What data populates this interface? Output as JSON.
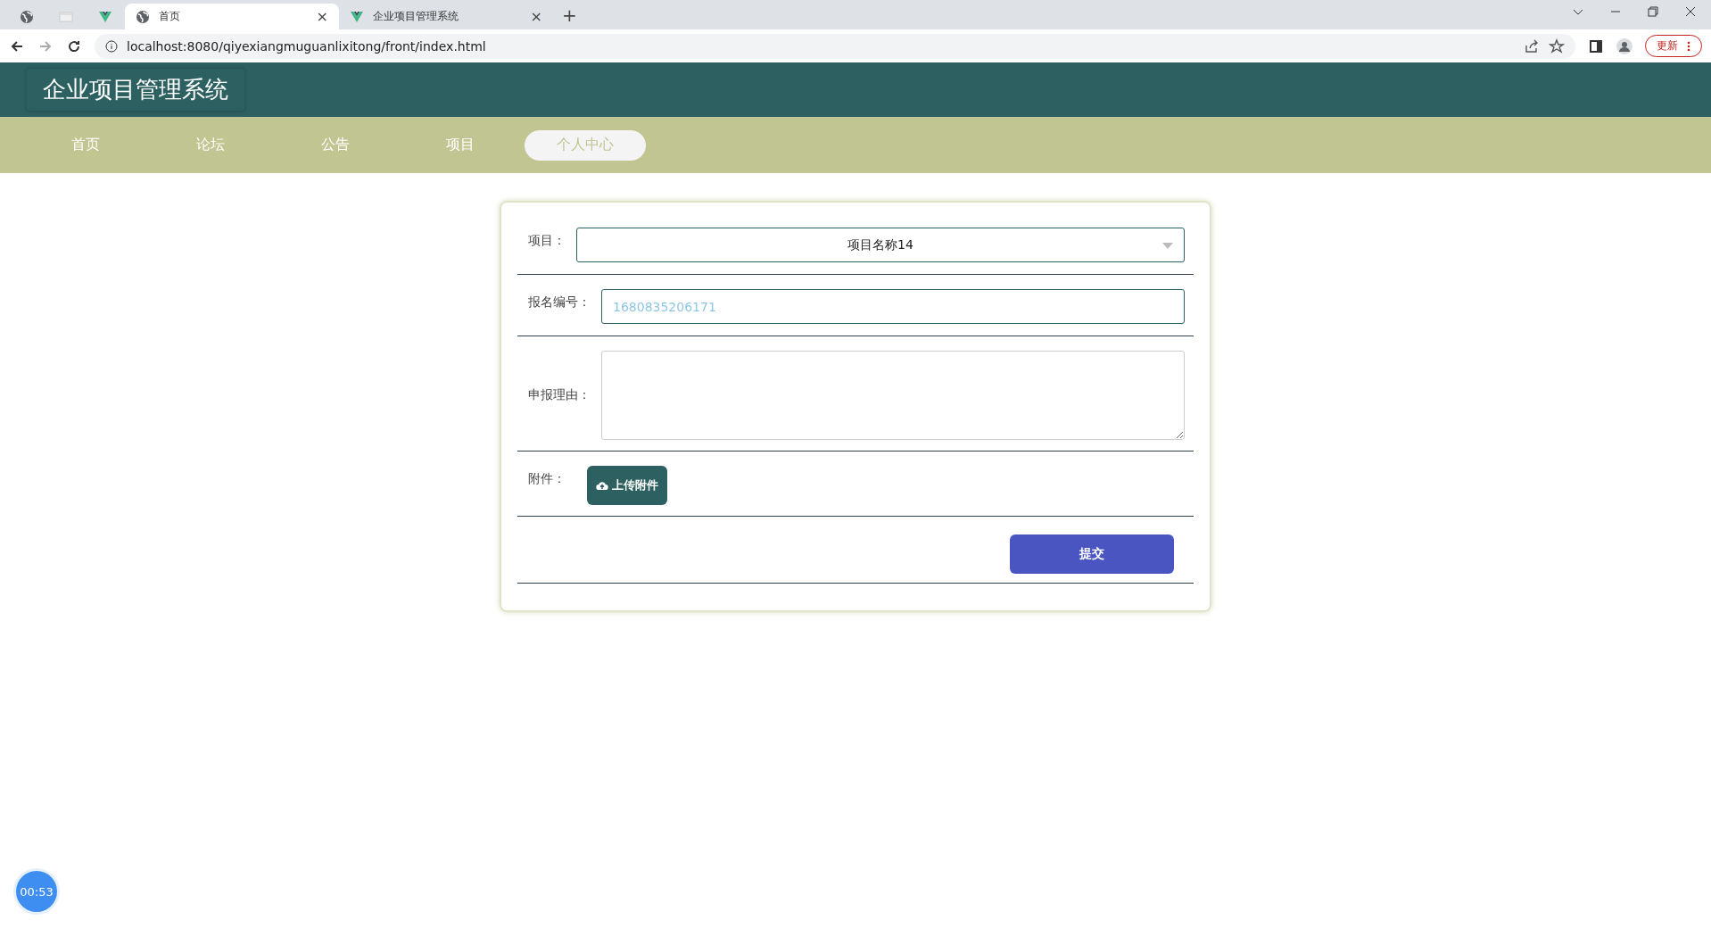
{
  "browser": {
    "tabs": [
      {
        "kind": "pinned-globe",
        "selected": false
      },
      {
        "kind": "pinned-sheet",
        "selected": false
      },
      {
        "kind": "pinned-v",
        "selected": false
      },
      {
        "kind": "page-globe",
        "title": "首页",
        "close": "×",
        "selected": true
      },
      {
        "kind": "page-v",
        "title": "企业项目管理系统",
        "close": "×",
        "selected": false
      }
    ],
    "new_tab": "+",
    "address": "localhost:8080/qiyexiangmuguanlixitong/front/index.html",
    "update_button": "更新"
  },
  "header": {
    "title": "企业项目管理系统"
  },
  "nav": [
    {
      "label": "首页",
      "selected": false
    },
    {
      "label": "论坛",
      "selected": false
    },
    {
      "label": "公告",
      "selected": false
    },
    {
      "label": "项目",
      "selected": false
    },
    {
      "label": "个人中心",
      "selected": true
    }
  ],
  "form": {
    "fields": [
      {
        "kind": "select",
        "label": "项目：",
        "value": "项目名称14"
      },
      {
        "kind": "text",
        "label": "报名编号：",
        "value": "1680835206171"
      },
      {
        "kind": "textarea",
        "label": "申报理由："
      },
      {
        "kind": "upload",
        "label": "附件：",
        "button": "上传附件"
      }
    ],
    "submit": "提交"
  },
  "timer": "00:53"
}
